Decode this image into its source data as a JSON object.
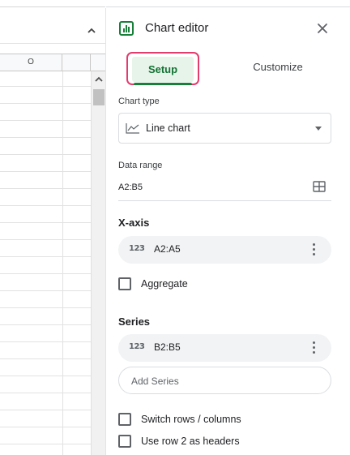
{
  "sheet": {
    "column_header": "O"
  },
  "editor": {
    "title": "Chart editor",
    "tabs": [
      {
        "label": "Setup",
        "active": true
      },
      {
        "label": "Customize",
        "active": false
      }
    ],
    "chart_type": {
      "label": "Chart type",
      "value": "Line chart"
    },
    "data_range": {
      "label": "Data range",
      "value": "A2:B5"
    },
    "x_axis": {
      "heading": "X-axis",
      "item": {
        "type_glyph": "123",
        "value": "A2:A5"
      },
      "aggregate_label": "Aggregate"
    },
    "series": {
      "heading": "Series",
      "item": {
        "type_glyph": "123",
        "value": "B2:B5"
      },
      "add_placeholder": "Add Series"
    },
    "options": [
      {
        "label": "Switch rows / columns",
        "checked": false
      },
      {
        "label": "Use row 2 as headers",
        "checked": false
      }
    ]
  },
  "colors": {
    "tab_active_text": "#137333",
    "tab_active_bg": "#e6f4ea",
    "tab_highlight_border": "#e33b6d",
    "chart_icon_green": "#188038"
  },
  "icons": {
    "editor_title_icon": "bar-chart-icon",
    "close": "close-icon",
    "chart_type": "line-chart-icon",
    "data_range": "grid-select-icon",
    "more": "more-vert-icon"
  }
}
